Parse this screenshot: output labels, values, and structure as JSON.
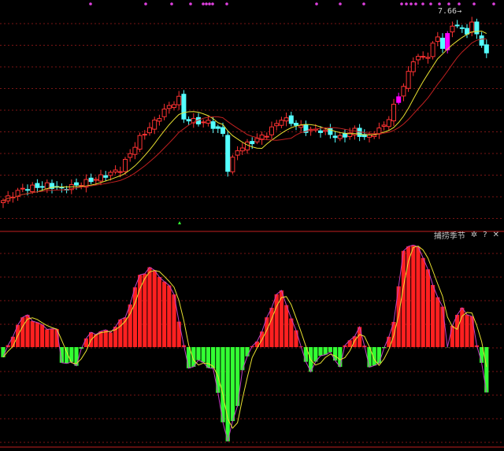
{
  "chart_data": [
    {
      "type": "candlestick",
      "title": "",
      "bar_count": 100,
      "price_range": [
        3.0,
        7.66
      ],
      "highest_label": "7.66",
      "close_keypoints": [
        [
          0,
          3.06
        ],
        [
          4,
          3.35
        ],
        [
          9,
          3.44
        ],
        [
          12,
          3.35
        ],
        [
          15,
          3.44
        ],
        [
          20,
          3.64
        ],
        [
          24,
          3.83
        ],
        [
          26,
          4.22
        ],
        [
          28,
          4.6
        ],
        [
          31,
          4.99
        ],
        [
          33,
          5.28
        ],
        [
          36,
          5.57
        ],
        [
          37,
          5.08
        ],
        [
          40,
          4.99
        ],
        [
          42,
          4.99
        ],
        [
          45,
          4.7
        ],
        [
          46,
          3.83
        ],
        [
          48,
          4.31
        ],
        [
          51,
          4.51
        ],
        [
          54,
          4.7
        ],
        [
          57,
          5.08
        ],
        [
          59,
          4.99
        ],
        [
          62,
          4.79
        ],
        [
          65,
          4.79
        ],
        [
          69,
          4.6
        ],
        [
          72,
          4.79
        ],
        [
          74,
          4.6
        ],
        [
          77,
          4.79
        ],
        [
          79,
          5.08
        ],
        [
          81,
          5.66
        ],
        [
          82,
          5.86
        ],
        [
          84,
          6.53
        ],
        [
          87,
          6.63
        ],
        [
          89,
          7.11
        ],
        [
          90,
          6.82
        ],
        [
          92,
          7.4
        ],
        [
          95,
          7.21
        ],
        [
          96,
          7.4
        ],
        [
          98,
          6.92
        ],
        [
          99,
          6.63
        ]
      ],
      "moving_averages": [
        {
          "name": "MA-fast",
          "color": "#e8e030",
          "period": 8
        },
        {
          "name": "MA-slow",
          "color": "#c02020",
          "period": 14
        }
      ],
      "colors": {
        "up": "#ff3232",
        "down": "#54ffff",
        "special": "#ff00ff"
      }
    },
    {
      "type": "bar",
      "title": "捕捞季节",
      "value_range": [
        -95,
        105
      ],
      "value_keypoints": [
        [
          0,
          -10
        ],
        [
          1,
          0
        ],
        [
          3,
          23
        ],
        [
          5,
          32
        ],
        [
          7,
          23
        ],
        [
          11,
          16
        ],
        [
          12,
          -14
        ],
        [
          15,
          -18
        ],
        [
          16,
          0
        ],
        [
          18,
          14
        ],
        [
          22,
          16
        ],
        [
          25,
          30
        ],
        [
          28,
          71
        ],
        [
          30,
          78
        ],
        [
          32,
          71
        ],
        [
          35,
          53
        ],
        [
          37,
          0
        ],
        [
          38,
          -21
        ],
        [
          40,
          -14
        ],
        [
          43,
          -21
        ],
        [
          45,
          -73
        ],
        [
          46,
          -92
        ],
        [
          48,
          -58
        ],
        [
          49,
          -21
        ],
        [
          51,
          0
        ],
        [
          53,
          15
        ],
        [
          56,
          53
        ],
        [
          57,
          54
        ],
        [
          59,
          30
        ],
        [
          61,
          0
        ],
        [
          63,
          -25
        ],
        [
          65,
          -7
        ],
        [
          67,
          -7
        ],
        [
          69,
          -18
        ],
        [
          70,
          0
        ],
        [
          73,
          19
        ],
        [
          74,
          0
        ],
        [
          75,
          -18
        ],
        [
          77,
          -18
        ],
        [
          78,
          0
        ],
        [
          80,
          23
        ],
        [
          82,
          97
        ],
        [
          85,
          101
        ],
        [
          87,
          75
        ],
        [
          90,
          38
        ],
        [
          91,
          0
        ],
        [
          92,
          23
        ],
        [
          94,
          38
        ],
        [
          96,
          30
        ],
        [
          97,
          0
        ],
        [
          98,
          -14
        ],
        [
          99,
          -44
        ]
      ],
      "colors": {
        "positive": "#ff2020",
        "negative": "#33ff33",
        "line1": "#e8e030",
        "line2": "#c040c0"
      }
    }
  ],
  "indicator_toolbar": {
    "name": "捕捞季节",
    "settings_icon": "gear-icon",
    "help": "?",
    "close": "✕"
  }
}
